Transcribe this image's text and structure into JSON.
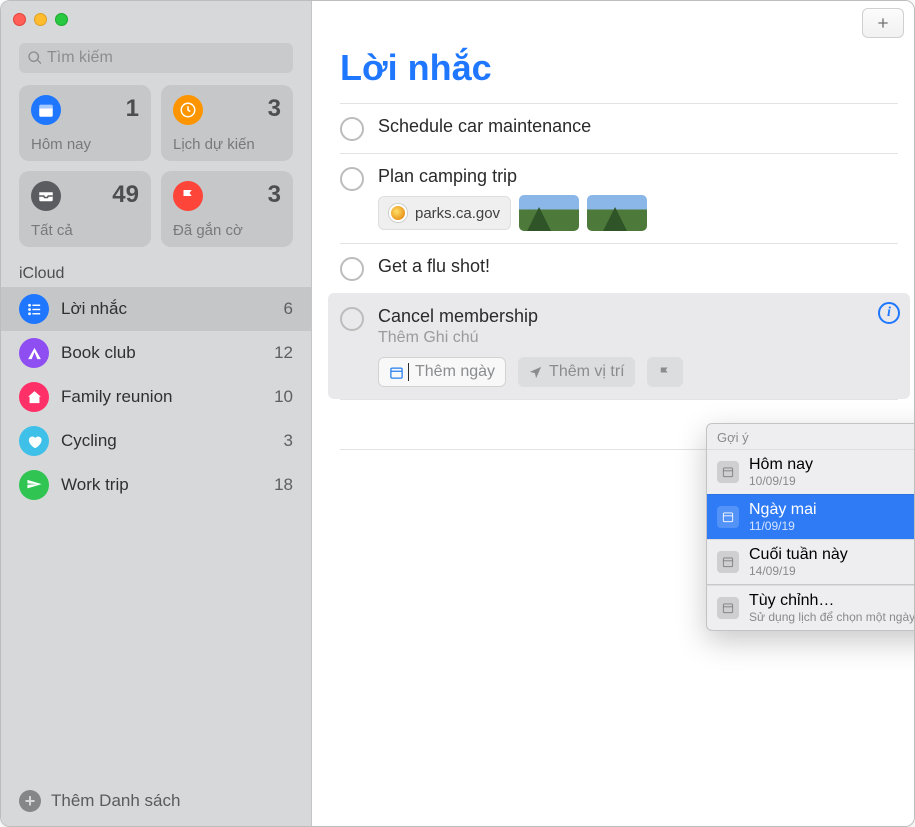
{
  "search": {
    "placeholder": "Tìm kiếm"
  },
  "cards": {
    "today": {
      "label": "Hôm nay",
      "count": "1",
      "color": "#1f77ff"
    },
    "scheduled": {
      "label": "Lịch dự kiến",
      "count": "3",
      "color": "#fd9500"
    },
    "all": {
      "label": "Tất cả",
      "count": "49",
      "color": "#5b5c60"
    },
    "flagged": {
      "label": "Đã gắn cờ",
      "count": "3",
      "color": "#fe4539"
    }
  },
  "section_label": "iCloud",
  "lists": [
    {
      "name": "Lời nhắc",
      "count": "6",
      "color": "#1f77ff",
      "icon": "list",
      "selected": true
    },
    {
      "name": "Book club",
      "count": "12",
      "color": "#8f4ef2",
      "icon": "tent",
      "selected": false
    },
    {
      "name": "Family reunion",
      "count": "10",
      "color": "#ff2f68",
      "icon": "house",
      "selected": false
    },
    {
      "name": "Cycling",
      "count": "3",
      "color": "#3fc0e8",
      "icon": "heart",
      "selected": false
    },
    {
      "name": "Work trip",
      "count": "18",
      "color": "#30c552",
      "icon": "airplane",
      "selected": false
    }
  ],
  "footer": {
    "add_list": "Thêm Danh sách"
  },
  "main": {
    "title": "Lời nhắc",
    "reminders": [
      {
        "title": "Schedule car maintenance"
      },
      {
        "title": "Plan camping trip",
        "link_label": "parks.ca.gov"
      },
      {
        "title": "Get a flu shot!"
      },
      {
        "title": "Cancel membership",
        "note_placeholder": "Thêm Ghi chú",
        "add_date": "Thêm ngày",
        "add_location": "Thêm vị trí",
        "active": true
      }
    ]
  },
  "popover": {
    "heading": "Gợi ý",
    "items": [
      {
        "title": "Hôm nay",
        "sub": "10/09/19",
        "selected": false
      },
      {
        "title": "Ngày mai",
        "sub": "11/09/19",
        "selected": true
      },
      {
        "title": "Cuối tuần này",
        "sub": "14/09/19",
        "selected": false
      }
    ],
    "custom": {
      "title": "Tùy chỉnh…",
      "sub": "Sử dụng lịch để chọn một ngày"
    }
  }
}
